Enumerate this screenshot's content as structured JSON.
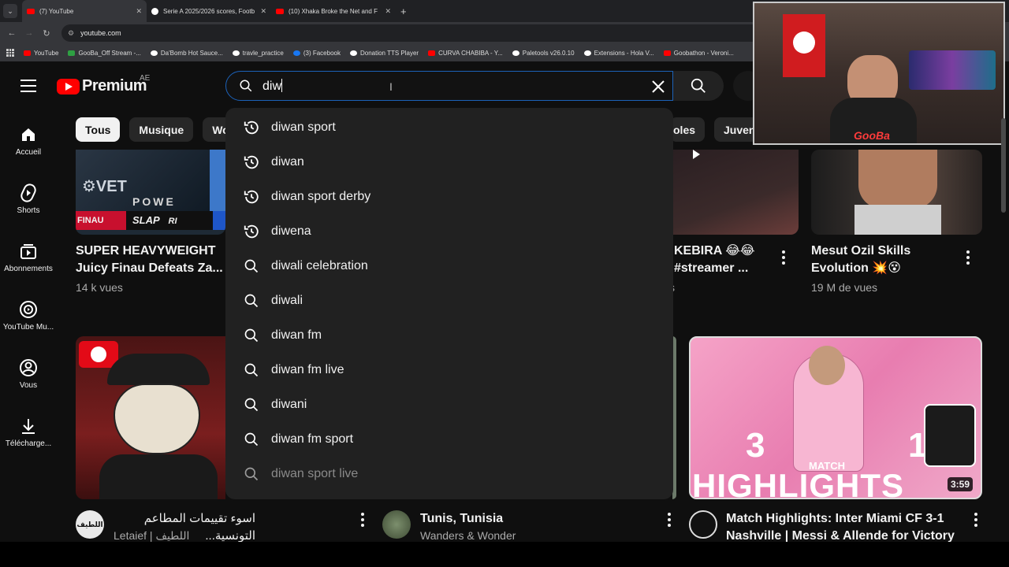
{
  "browser": {
    "tabs": [
      {
        "title": "(7) YouTube",
        "active": true,
        "favicon": "youtube"
      },
      {
        "title": "Serie A 2025/2026 scores, Footb",
        "active": false,
        "favicon": "google"
      },
      {
        "title": "(10) Xhaka Broke the Net and F",
        "active": false,
        "favicon": "youtube"
      }
    ],
    "new_tab": "+",
    "tab_close": "✕",
    "url": "youtube.com",
    "bookmarks": [
      {
        "label": "YouTube",
        "kind": "yt"
      },
      {
        "label": "GooBa_Off Stream -...",
        "kind": "k"
      },
      {
        "label": "Da'Bomb Hot Sauce...",
        "kind": "c"
      },
      {
        "label": "travle_practice",
        "kind": "c"
      },
      {
        "label": "(3) Facebook",
        "kind": "f"
      },
      {
        "label": "Donation TTS Player",
        "kind": "c"
      },
      {
        "label": "CURVA CHABIBA - Y...",
        "kind": "yt"
      },
      {
        "label": "Paletools v26.0.10",
        "kind": "c"
      },
      {
        "label": "Extensions - Hola V...",
        "kind": "c"
      },
      {
        "label": "Goobathon - Veroni...",
        "kind": "yt"
      }
    ]
  },
  "header": {
    "logo_text": "Premium",
    "country": "AE",
    "search_value": "diw"
  },
  "sidebar": [
    {
      "label": "Accueil",
      "icon": "home-icon"
    },
    {
      "label": "Shorts",
      "icon": "shorts-icon"
    },
    {
      "label": "Abonnements",
      "icon": "subscriptions-icon"
    },
    {
      "label": "YouTube Mu...",
      "icon": "youtube-music-icon"
    },
    {
      "label": "Vous",
      "icon": "you-icon"
    },
    {
      "label": "Télécharge...",
      "icon": "download-icon"
    }
  ],
  "chips": [
    "Tous",
    "Musique",
    "Wo"
  ],
  "chips_right": [
    "oles",
    "Juvent"
  ],
  "suggestions": [
    {
      "text": "diwan sport",
      "type": "history"
    },
    {
      "text": "diwan",
      "type": "history"
    },
    {
      "text": "diwan sport derby",
      "type": "history"
    },
    {
      "text": "diwena",
      "type": "history"
    },
    {
      "text": "diwali celebration",
      "type": "search"
    },
    {
      "text": "diwali",
      "type": "search"
    },
    {
      "text": "diwan fm",
      "type": "search"
    },
    {
      "text": "diwan fm live",
      "type": "search"
    },
    {
      "text": "diwani",
      "type": "search"
    },
    {
      "text": "diwan fm sport",
      "type": "search"
    },
    {
      "text": "diwan sport live",
      "type": "search"
    }
  ],
  "videos": {
    "v1": {
      "title1": "SUPER HEAVYWEIGHT",
      "title2": "Juicy Finau Defeats Za...",
      "meta": "14 k vues",
      "thumb_text1": "FINAU",
      "thumb_text2": "SLAP",
      "thumb_text3": "RI",
      "thumb_text4": "POWE"
    },
    "v2": {
      "title1": "KEBIRA 😂😂",
      "title2": "#streamer ...",
      "meta": "s"
    },
    "v3": {
      "title1": "Mesut Ozil Skills",
      "title2": "Evolution 💥😵",
      "meta": "19 M de vues"
    },
    "v4": {
      "title": "اسوء تقييمات المطاعم التونسية...",
      "channel": "Letaief | اللطيف"
    },
    "v5": {
      "title": "Tunis, Tunisia",
      "channel": "Wanders & Wonder"
    },
    "v6": {
      "title1": "Match Highlights: Inter Miami CF 3-1",
      "title2": "Nashville | Messi & Allende for Victory",
      "duration": "3:59",
      "score_left": "3",
      "score_right": "1",
      "thumb_big": "HIGHLIGHTS",
      "thumb_small": "MATCH"
    }
  },
  "webcam": {
    "badge": "GooBa"
  },
  "colors": {
    "accent": "#ff0000",
    "search_border": "#1c62b9",
    "bg": "#0f0f0f"
  }
}
